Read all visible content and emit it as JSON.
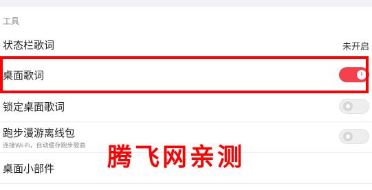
{
  "section": {
    "header": "工具"
  },
  "rows": [
    {
      "label": "状态栏歌词",
      "value": "未开启"
    },
    {
      "label": "桌面歌词",
      "toggle": "on"
    },
    {
      "label": "锁定桌面歌词",
      "toggle": "off"
    },
    {
      "label": "跑步漫游离线包",
      "sublabel": "连接Wi-Fi，自动缓存跑步歌曲",
      "toggle": "off"
    },
    {
      "label": "桌面小部件"
    }
  ],
  "watermark": "腾飞网亲测",
  "colors": {
    "toggle_on": "#f5414b",
    "highlight": "#ff0000"
  }
}
